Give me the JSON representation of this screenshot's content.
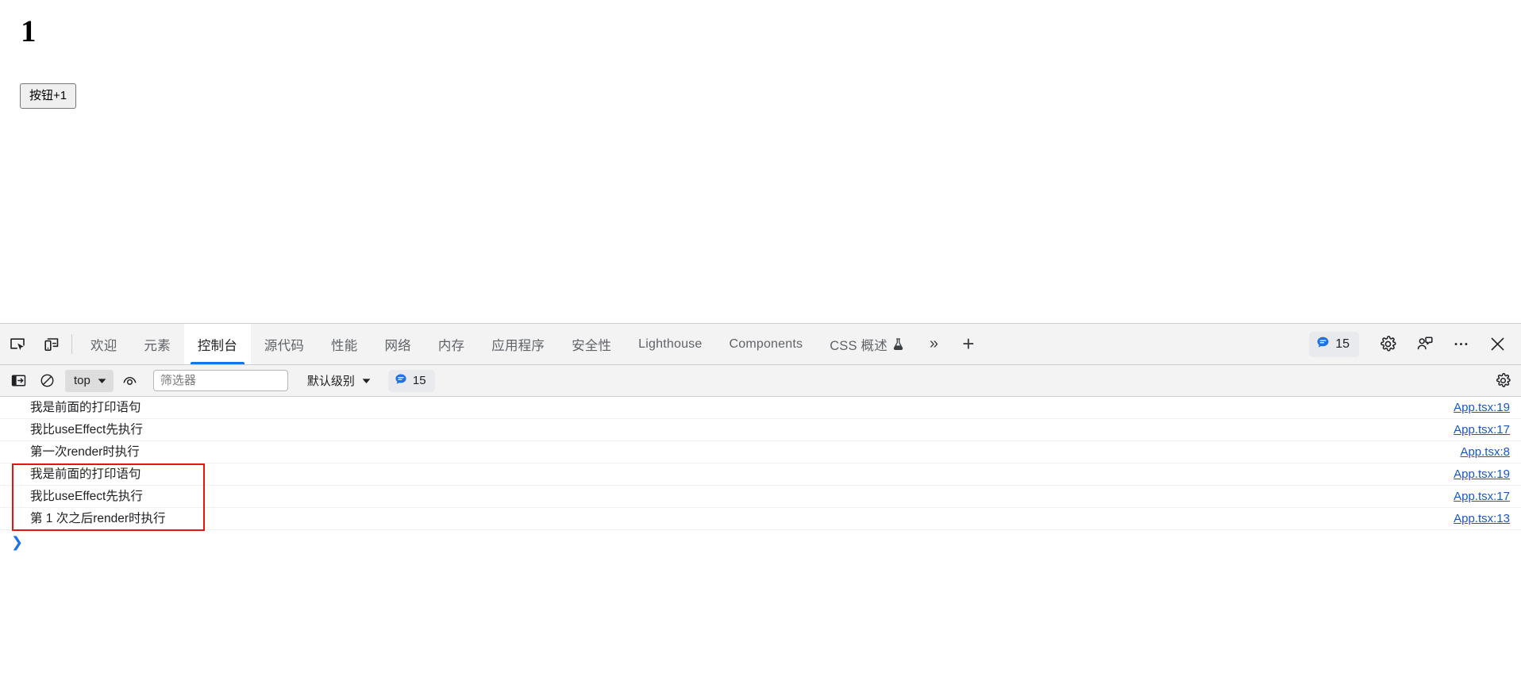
{
  "page": {
    "counter_value": "1",
    "button_label": "按钮+1"
  },
  "devtools": {
    "tabstrip": {
      "inspect_icon": "inspect-element-icon",
      "device_icon": "device-toolbar-icon",
      "tabs": [
        {
          "label": "欢迎",
          "active": false,
          "latin": false
        },
        {
          "label": "元素",
          "active": false,
          "latin": false
        },
        {
          "label": "控制台",
          "active": true,
          "latin": false
        },
        {
          "label": "源代码",
          "active": false,
          "latin": false
        },
        {
          "label": "性能",
          "active": false,
          "latin": false
        },
        {
          "label": "网络",
          "active": false,
          "latin": false
        },
        {
          "label": "内存",
          "active": false,
          "latin": false
        },
        {
          "label": "应用程序",
          "active": false,
          "latin": false
        },
        {
          "label": "安全性",
          "active": false,
          "latin": false
        },
        {
          "label": "Lighthouse",
          "active": false,
          "latin": true
        },
        {
          "label": "Components",
          "active": false,
          "latin": true
        },
        {
          "label": "CSS 概述",
          "active": false,
          "latin": false,
          "experiment": true
        }
      ],
      "more_tabs_label": "»",
      "add_tab_label": "+",
      "message_count": "15",
      "settings_icon": "gear-icon",
      "feedback_icon": "feedback-icon",
      "more_options_icon": "more-options-icon",
      "close_icon": "close-icon"
    },
    "console_toolbar": {
      "sidebar_icon": "console-sidebar-icon",
      "clear_icon": "clear-console-icon",
      "context": "top",
      "eye_icon": "live-expression-icon",
      "filter_placeholder": "筛选器",
      "filter_value": "",
      "level": "默认级别",
      "message_count": "15",
      "settings_icon": "gear-icon"
    },
    "console": {
      "messages": [
        {
          "text": "我是前面的打印语句",
          "source": "App.tsx:19"
        },
        {
          "text": "我比useEffect先执行",
          "source": "App.tsx:17"
        },
        {
          "text": "第一次render时执行",
          "source": "App.tsx:8"
        },
        {
          "text": "我是前面的打印语句",
          "source": "App.tsx:19"
        },
        {
          "text": "我比useEffect先执行",
          "source": "App.tsx:17"
        },
        {
          "text": "第 1 次之后render时执行",
          "source": "App.tsx:13"
        }
      ],
      "prompt_caret": "❯",
      "annotation_color": "#e81313"
    }
  }
}
